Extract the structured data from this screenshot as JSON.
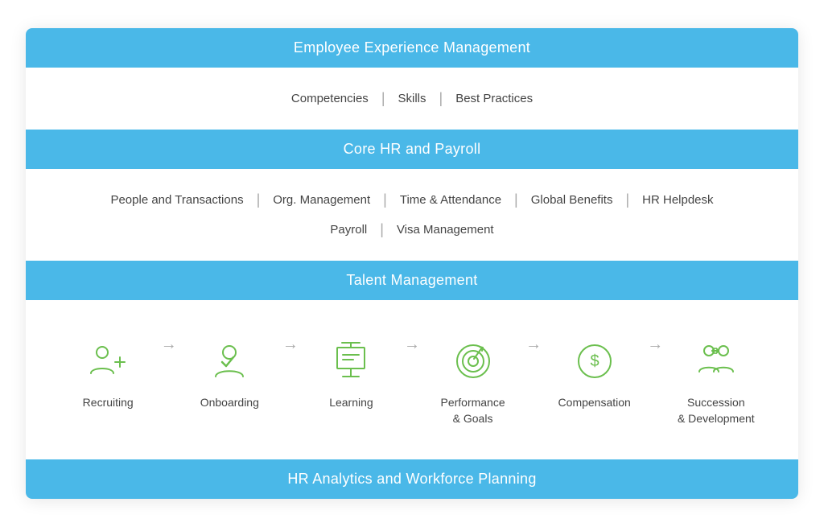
{
  "sections": {
    "emp_exp": {
      "header": "Employee Experience Management",
      "items": [
        "Competencies",
        "Skills",
        "Best Practices"
      ]
    },
    "core_hr": {
      "header": "Core HR and Payroll",
      "row1": [
        "People and Transactions",
        "Org. Management",
        "Time & Attendance",
        "Global Benefits",
        "HR Helpdesk"
      ],
      "row2": [
        "Payroll",
        "Visa Management"
      ]
    },
    "talent": {
      "header": "Talent Management",
      "items": [
        {
          "label": "Recruiting",
          "icon": "recruiting"
        },
        {
          "label": "Onboarding",
          "icon": "onboarding"
        },
        {
          "label": "Learning",
          "icon": "learning"
        },
        {
          "label": "Performance\n& Goals",
          "icon": "performance"
        },
        {
          "label": "Compensation",
          "icon": "compensation"
        },
        {
          "label": "Succession\n& Development",
          "icon": "succession"
        }
      ]
    },
    "analytics": {
      "header": "HR Analytics and Workforce Planning"
    }
  },
  "colors": {
    "header_bg": "#4ab8e8",
    "icon_stroke": "#6bbf4e",
    "text": "#444444",
    "separator": "#aaaaaa"
  }
}
